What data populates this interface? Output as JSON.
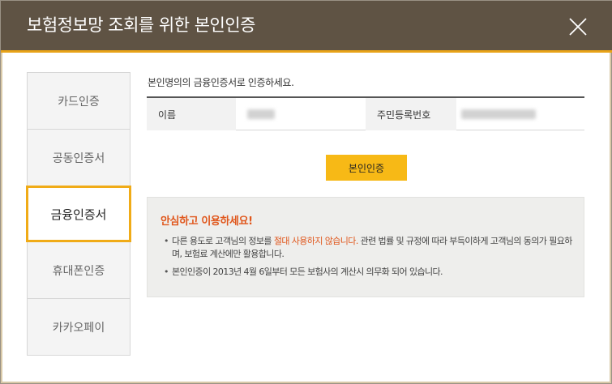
{
  "header": {
    "title": "보험정보망 조회를 위한 본인인증",
    "close_icon": "close-x-icon"
  },
  "sidebar": {
    "items": [
      {
        "label": "카드인증",
        "active": false
      },
      {
        "label": "공동인증서",
        "active": false
      },
      {
        "label": "금융인증서",
        "active": true
      },
      {
        "label": "휴대폰인증",
        "active": false
      },
      {
        "label": "카카오페이",
        "active": false
      }
    ]
  },
  "main": {
    "instruction": "본인명의의 금융인증서로 인증하세요.",
    "table": {
      "name_label": "이름",
      "rrn_label": "주민등록번호"
    },
    "auth_button_label": "본인인증",
    "notice": {
      "title": "안심하고 이용하세요!",
      "item1_before": "다른 용도로 고객님의 정보를 ",
      "item1_highlight": "절대 사용하지 않습니다.",
      "item1_after": " 관련 법률 및 규정에 따라 부득이하게 고객님의 동의가 필요하며, 보험료 계산에만 활용합니다.",
      "item2": "본인인증이 2013년 4월 6일부터 모든 보험사의 계산시 의무화 되어 있습니다."
    }
  },
  "colors": {
    "header_bg": "#5f5344",
    "accent": "#f0ab17",
    "button": "#f7b916",
    "highlight": "#e0561b"
  }
}
